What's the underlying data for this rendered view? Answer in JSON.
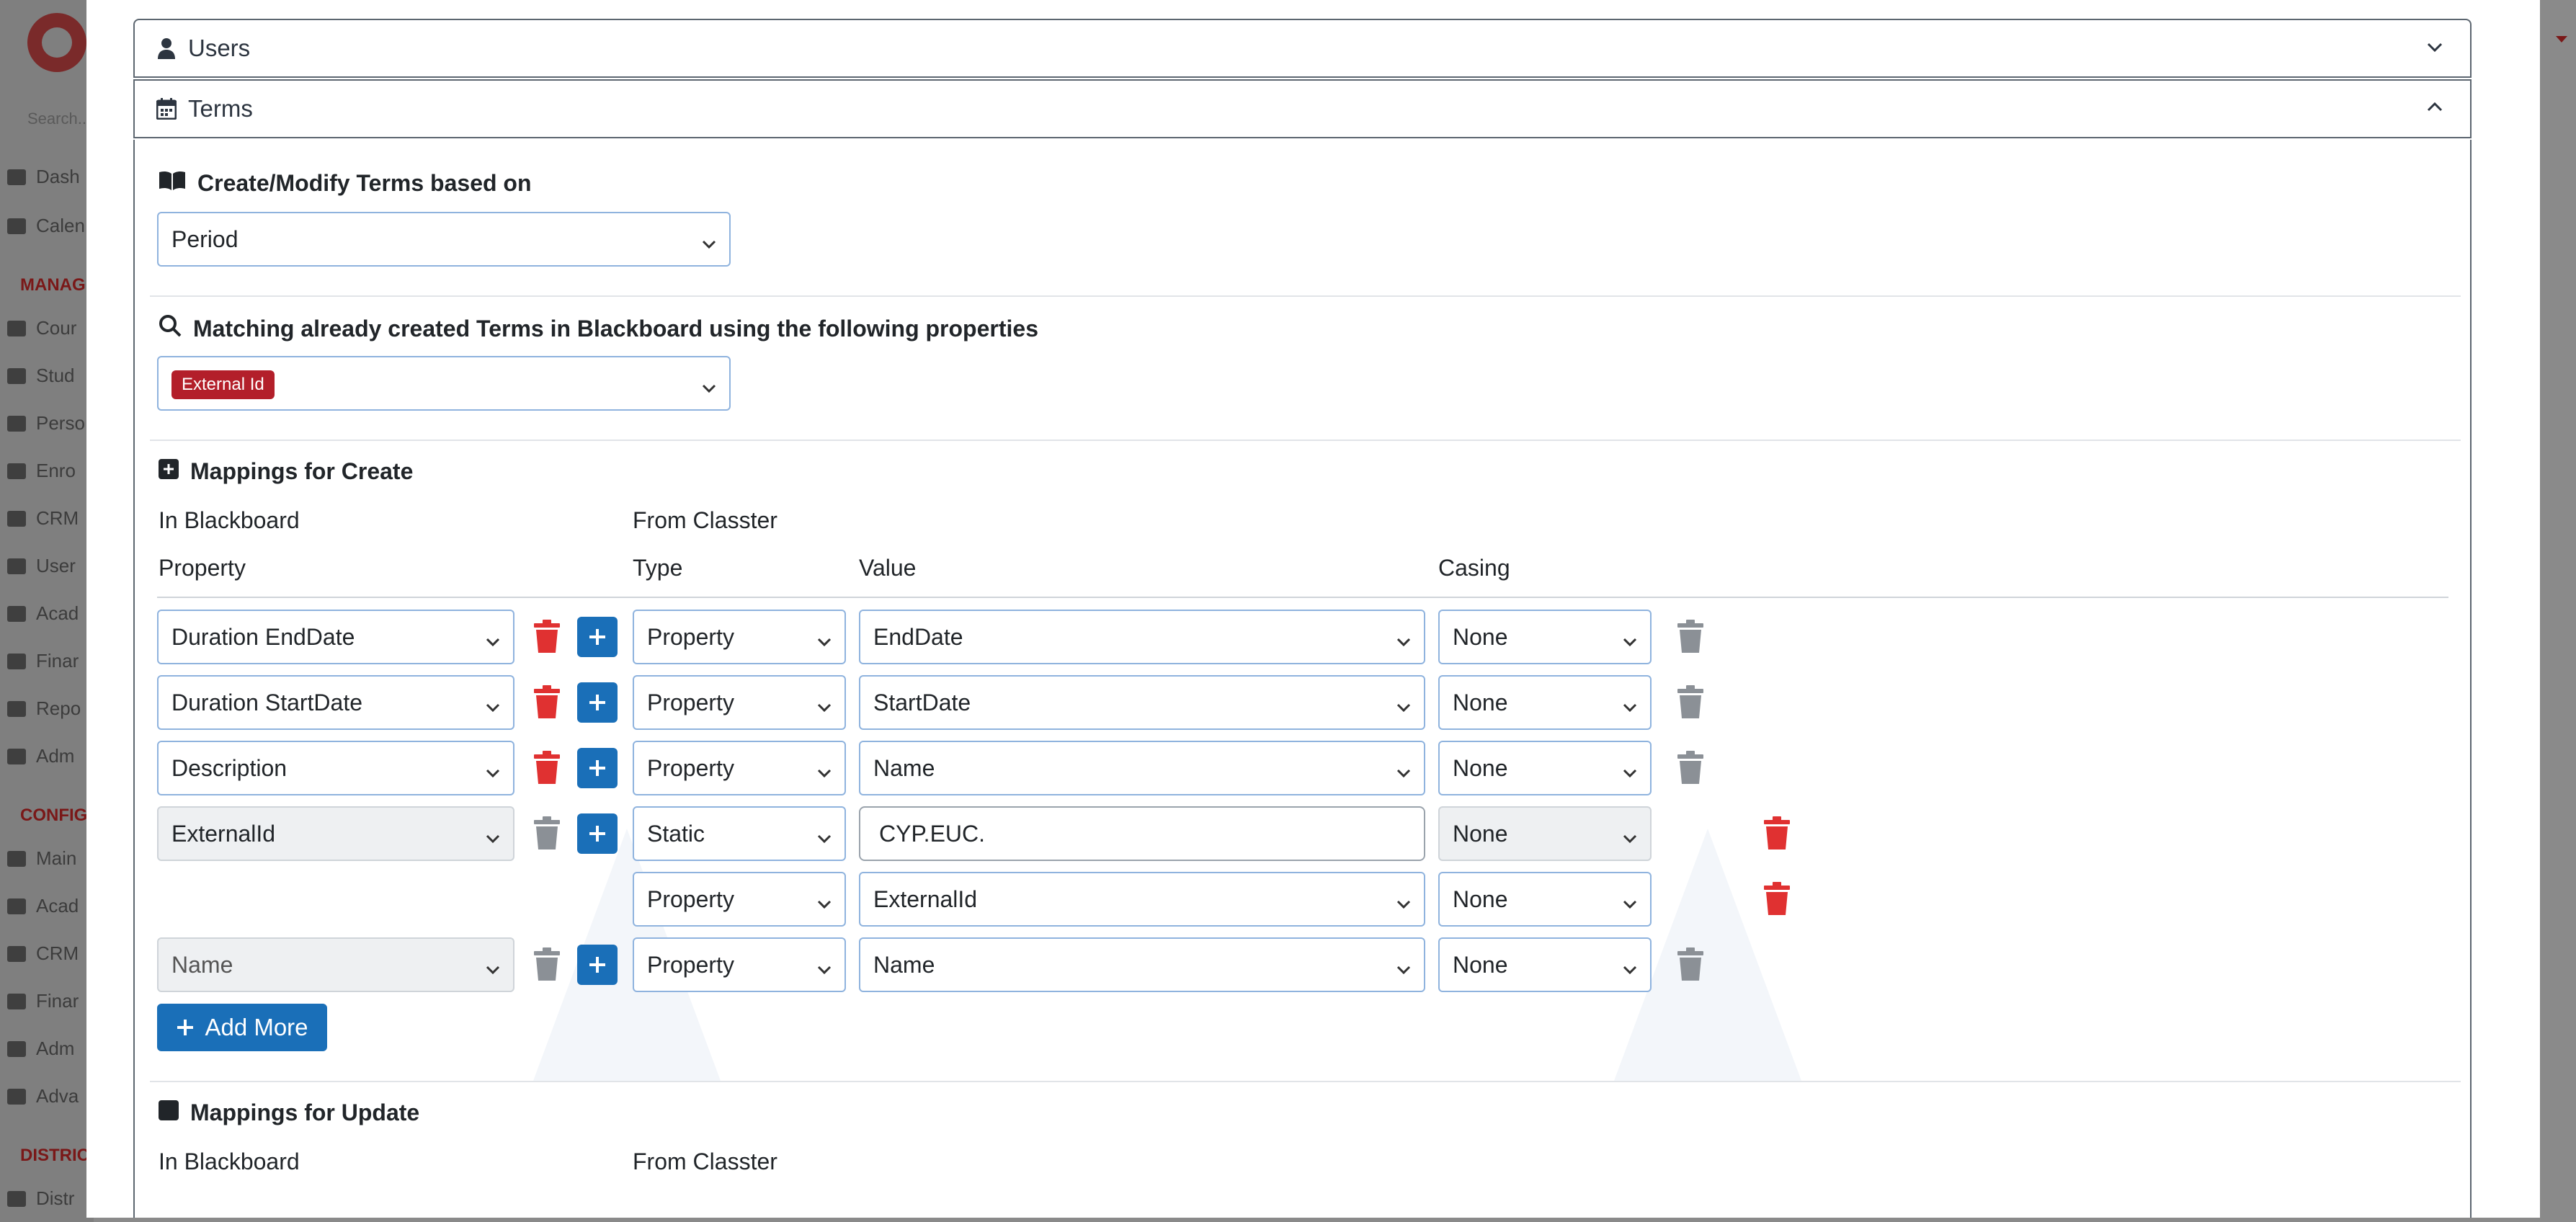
{
  "background": {
    "search_placeholder": "Search...",
    "nav_items": [
      {
        "label": "Dash",
        "icon": "laptop-icon"
      },
      {
        "label": "Calen",
        "icon": "calendar-icon"
      }
    ],
    "manage_section": "MANAG",
    "manage_items": [
      {
        "label": "Cour",
        "icon": "courses-icon"
      },
      {
        "label": "Stud",
        "icon": "students-icon"
      },
      {
        "label": "Perso",
        "icon": "person-icon"
      },
      {
        "label": "Enro",
        "icon": "enrollment-icon"
      },
      {
        "label": "CRM",
        "icon": "crm-icon"
      },
      {
        "label": "User",
        "icon": "user-key-icon"
      },
      {
        "label": "Acad",
        "icon": "academic-icon"
      },
      {
        "label": "Finar",
        "icon": "finance-icon"
      },
      {
        "label": "Repo",
        "icon": "report-icon"
      },
      {
        "label": "Adm",
        "icon": "admin-icon"
      }
    ],
    "config_section": "CONFIG",
    "config_items": [
      {
        "label": "Main",
        "icon": "maintenance-icon"
      },
      {
        "label": "Acad",
        "icon": "academic-icon"
      },
      {
        "label": "CRM",
        "icon": "crm-icon"
      },
      {
        "label": "Finar",
        "icon": "finance-icon"
      },
      {
        "label": "Adm",
        "icon": "admin-icon"
      },
      {
        "label": "Adva",
        "icon": "gear-icon"
      }
    ],
    "district_section": "DISTRIC",
    "district_items": [
      {
        "label": "Distr",
        "icon": "list-icon"
      }
    ]
  },
  "accordion": {
    "users_label": "Users",
    "terms_label": "Terms"
  },
  "terms": {
    "create_modify_label": "Create/Modify Terms based on",
    "create_modify_value": "Period",
    "matching_label": "Matching already created Terms in Blackboard using the following properties",
    "matching_tag": "External Id",
    "mappings_create_title": "Mappings for Create",
    "in_blackboard": "In Blackboard",
    "from_classter": "From Classter",
    "col_property": "Property",
    "col_type": "Type",
    "col_value": "Value",
    "col_casing": "Casing",
    "rows": [
      {
        "property": "Duration EndDate",
        "type": "Property",
        "value": "EndDate",
        "casing": "None"
      },
      {
        "property": "Duration StartDate",
        "type": "Property",
        "value": "StartDate",
        "casing": "None"
      },
      {
        "property": "Description",
        "type": "Property",
        "value": "Name",
        "casing": "None"
      },
      {
        "property": "ExternalId",
        "type": "Static",
        "value": "CYP.EUC.",
        "casing": "None"
      },
      {
        "property": "",
        "type": "Property",
        "value": "ExternalId",
        "casing": "None"
      },
      {
        "property": "Name",
        "type": "Property",
        "value": "Name",
        "casing": "None"
      }
    ],
    "add_more_label": "Add More",
    "mappings_update_title": "Mappings for Update",
    "update_in_blackboard": "In Blackboard",
    "update_from_classter": "From Classter"
  },
  "colors": {
    "primary": "#1a6fb8",
    "danger": "#e03131",
    "tag": "#b31f2a",
    "muted_trash": "#8b9096"
  }
}
